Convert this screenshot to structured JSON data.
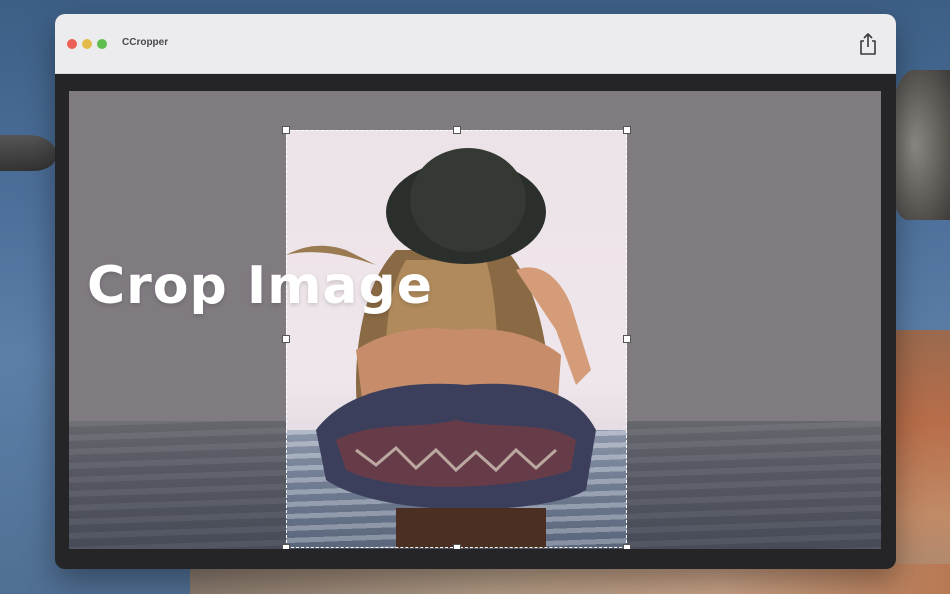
{
  "window": {
    "title": "CCropper"
  },
  "toolbar": {
    "share_icon": "share-icon"
  },
  "canvas": {
    "overlay_text": "Crop Image"
  },
  "colors": {
    "close": "#ec5f57",
    "minimize": "#e4ba4b",
    "maximize": "#5fbe4d",
    "titlebar": "#ececee",
    "window_bg": "#252527",
    "canvas_bg": "#807b81",
    "crop_border": "#ffffff"
  }
}
